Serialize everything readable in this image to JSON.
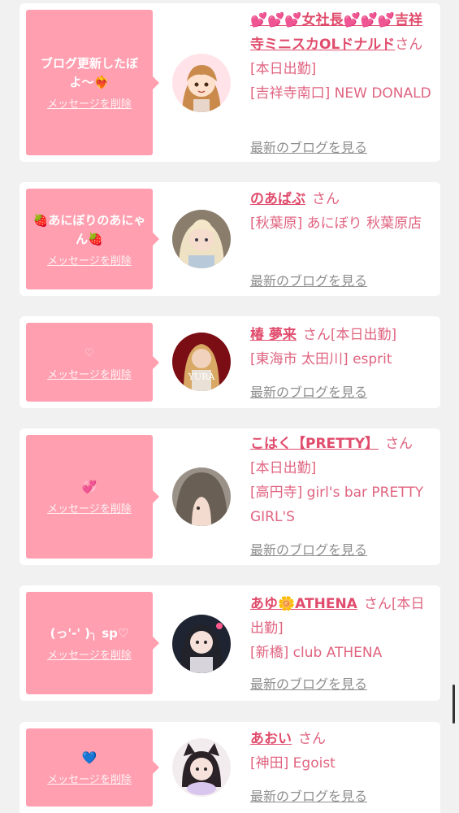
{
  "delete_label": "メッセージを削除",
  "blog_label": "最新のブログを見る",
  "san_label": "さん",
  "cards": [
    {
      "message": "ブログ更新したぼよ〜❤️‍🔥",
      "name": "💕💕💕女社長💕💕💕吉祥寺ミニスカOLドナルド",
      "after": "さん[本日出勤]",
      "lines": [
        "[吉祥寺南口] NEW DONALD"
      ],
      "avatar": "illustrated-girl-avatar"
    },
    {
      "message": "🍓あにぼりのあにゃん🍓",
      "name": "のあばぶ",
      "after": "さん",
      "lines": [
        "[秋葉原] あにぼり 秋葉原店"
      ],
      "avatar": "blonde-girl-avatar"
    },
    {
      "message": "♡",
      "name": "椿 夢来",
      "after": "さん[本日出勤]",
      "lines": [
        "[東海市 太田川] esprit"
      ],
      "avatar": "yura-birthday-avatar",
      "avatar_text": "YURA"
    },
    {
      "message": "💞",
      "name": "こはく【PRETTY】",
      "after": "さん",
      "lines": [
        "[本日出勤]",
        "[高円寺] girl's bar PRETTY GIRL'S"
      ],
      "avatar": "brown-hair-avatar"
    },
    {
      "message": "(っ'-' )╮ sp♡",
      "name": "あゆ🌼ATHENA",
      "after": "さん[本日出勤]",
      "lines": [
        "[新橋] club ATHENA"
      ],
      "avatar": "dark-hair-girl-avatar"
    },
    {
      "message": "💙",
      "name": "あおい",
      "after": "さん",
      "lines": [
        "[神田] Egoist"
      ],
      "avatar": "cat-ear-girl-avatar"
    }
  ]
}
